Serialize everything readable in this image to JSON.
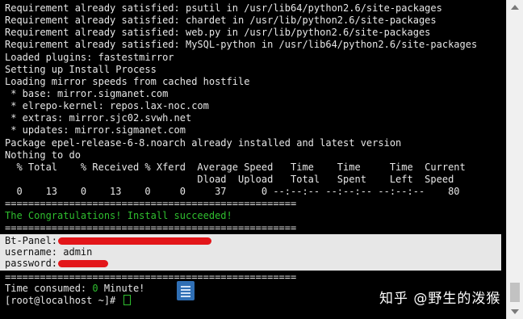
{
  "terminal": {
    "lines": [
      "Requirement already satisfied: psutil in /usr/lib64/python2.6/site-packages",
      "Requirement already satisfied: chardet in /usr/lib/python2.6/site-packages",
      "Requirement already satisfied: web.py in /usr/lib/python2.6/site-packages",
      "Requirement already satisfied: MySQL-python in /usr/lib64/python2.6/site-packages",
      "Loaded plugins: fastestmirror",
      "Setting up Install Process",
      "Loading mirror speeds from cached hostfile",
      " * base: mirror.sigmanet.com",
      " * elrepo-kernel: repos.lax-noc.com",
      " * extras: mirror.sjc02.svwh.net",
      " * updates: mirror.sigmanet.com",
      "Package epel-release-6-8.noarch already installed and latest version",
      "Nothing to do",
      "  % Total    % Received % Xferd  Average Speed   Time    Time     Time  Current",
      "                                 Dload  Upload   Total   Spent    Left  Speed",
      "  0    13    0    13    0     0     37      0 --:--:-- --:--:-- --:--:--    80",
      "==================================================",
      "The Congratulations! Install succeeded!",
      "==================================================",
      "Bt-Panel: ",
      "username: admin",
      "password: ",
      "==================================================",
      "Time consumed: ",
      "[root@localhost ~]# "
    ],
    "time_value": "0",
    "time_unit": " Minute!"
  },
  "watermark": "知乎 @野生的泼猴",
  "colors": {
    "background": "#000000",
    "text": "#e6e6e6",
    "success": "#2fbf2f",
    "highlight": "#e7e7e7",
    "redaction": "#e3161a"
  },
  "icons": [
    "document-icon",
    "scroll-up-icon",
    "scroll-down-icon",
    "cursor-block"
  ]
}
